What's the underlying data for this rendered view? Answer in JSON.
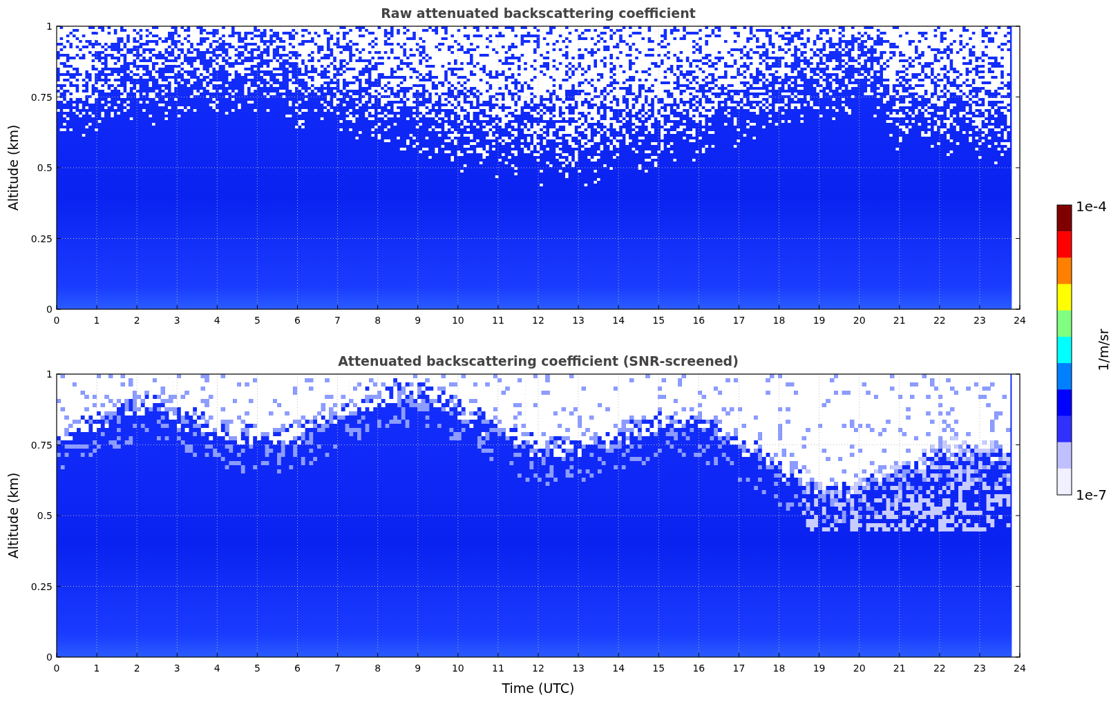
{
  "figure": {
    "panels": [
      {
        "kind": "raw",
        "title": "Raw attenuated backscattering coefficient",
        "ylabel": "Altitude (km)",
        "yticks": [
          "1",
          "0.75",
          "0.5",
          "0.25",
          "0"
        ],
        "xticks": [
          "0",
          "1",
          "2",
          "3",
          "4",
          "5",
          "6",
          "7",
          "8",
          "9",
          "10",
          "11",
          "12",
          "13",
          "14",
          "15",
          "16",
          "17",
          "18",
          "19",
          "20",
          "21",
          "22",
          "23",
          "24"
        ]
      },
      {
        "kind": "screened",
        "title": "Attenuated backscattering coefficient (SNR-screened)",
        "ylabel": "Altitude (km)",
        "yticks": [
          "1",
          "0.75",
          "0.5",
          "0.25",
          "0"
        ],
        "xticks": [
          "0",
          "1",
          "2",
          "3",
          "4",
          "5",
          "6",
          "7",
          "8",
          "9",
          "10",
          "11",
          "12",
          "13",
          "14",
          "15",
          "16",
          "17",
          "18",
          "19",
          "20",
          "21",
          "22",
          "23",
          "24"
        ]
      }
    ],
    "xlabel": "Time (UTC)",
    "colorbar": {
      "label": "1/m/sr",
      "max_label": "1e-4",
      "min_label": "1e-7"
    }
  }
}
